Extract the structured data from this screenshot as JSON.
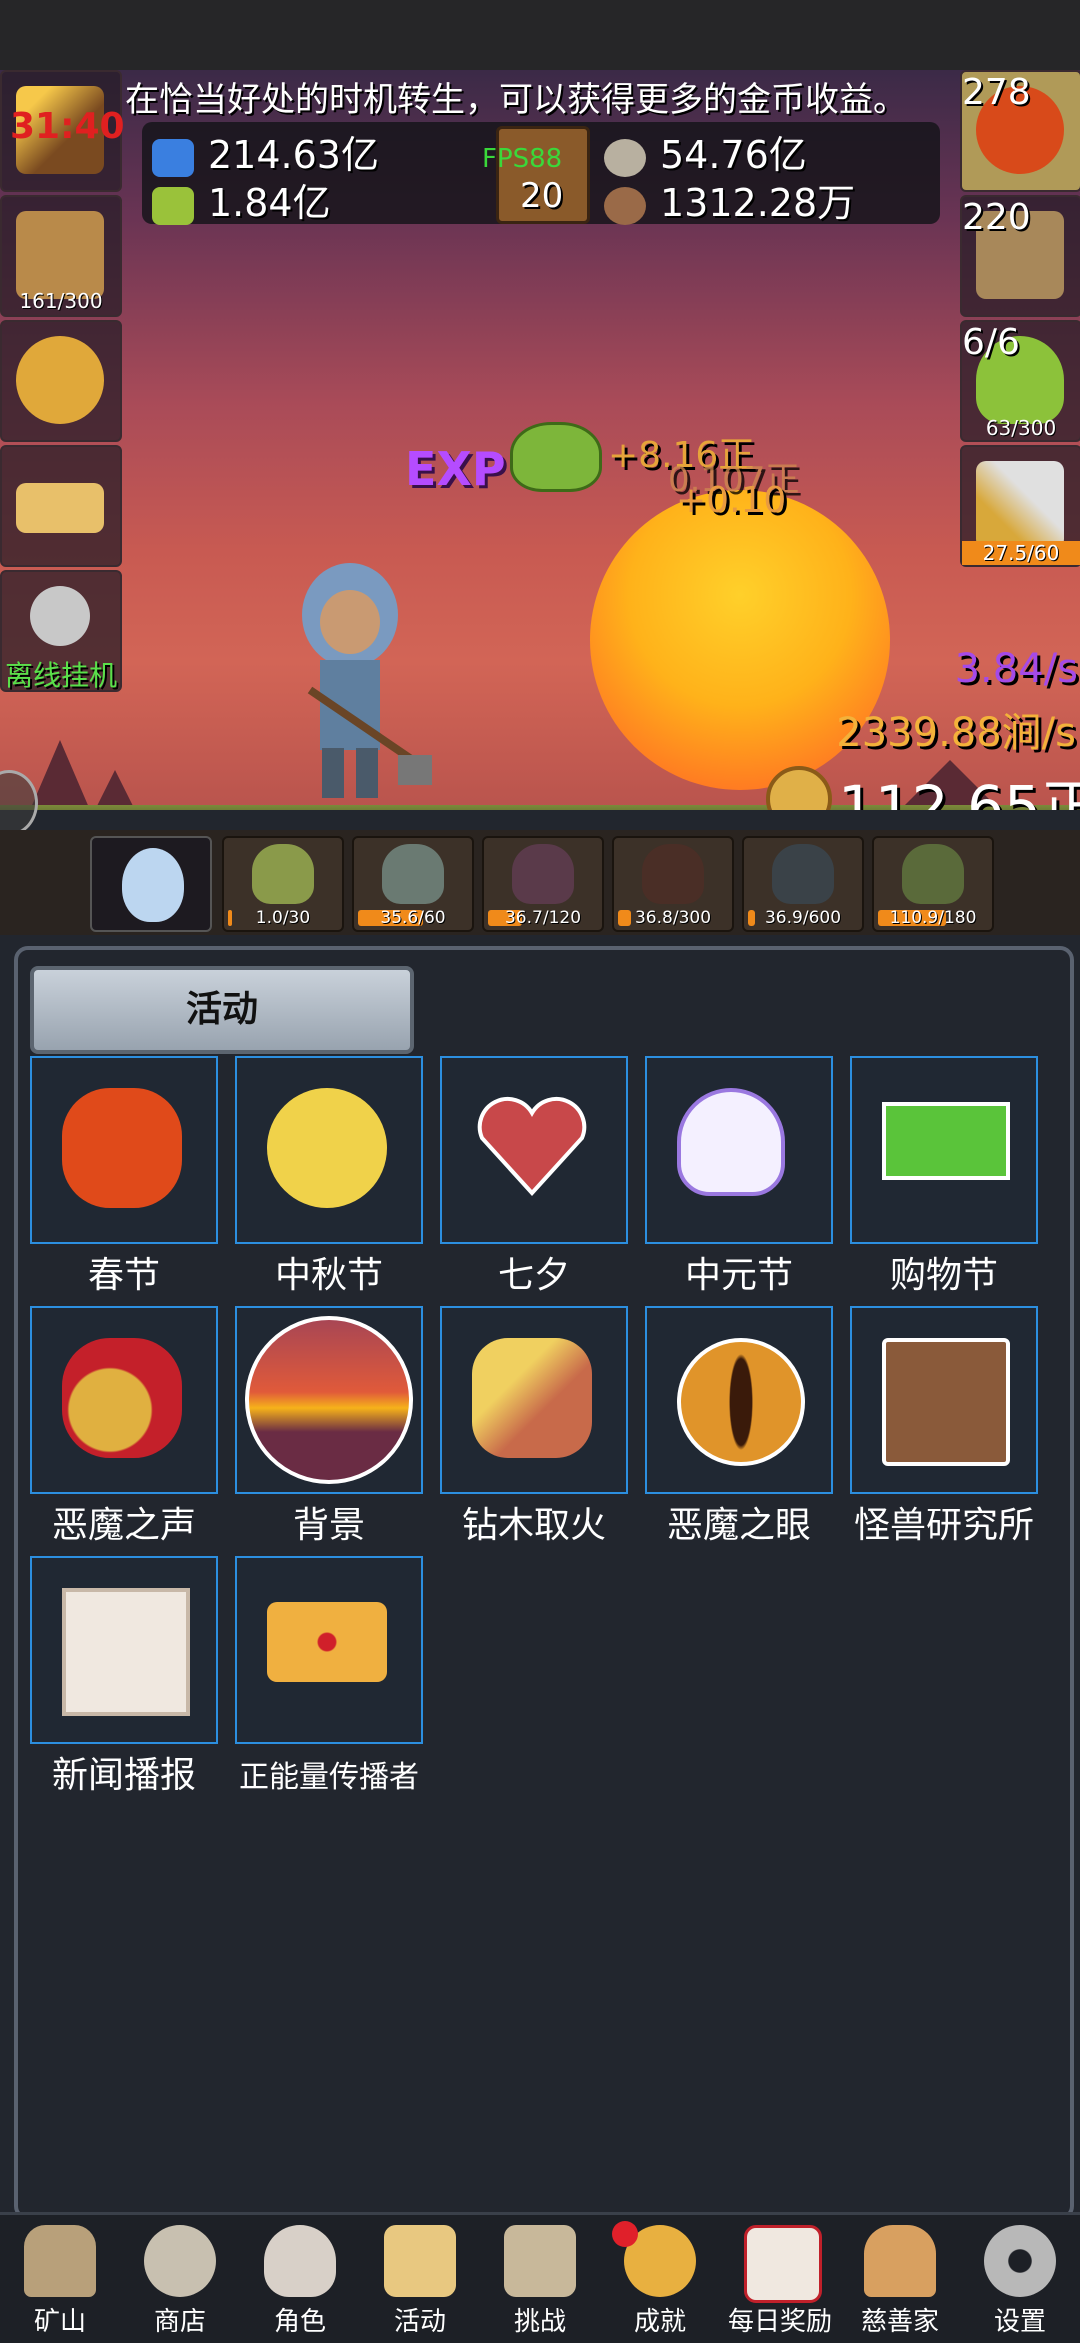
{
  "tip": "在恰当好处的时机转生，可以获得更多的金币收益。",
  "top_left_timer": "31:40",
  "side_left": [
    {
      "name": "torch",
      "count": ""
    },
    {
      "name": "beer",
      "count": "161/300"
    },
    {
      "name": "golden-key",
      "count": ""
    },
    {
      "name": "gold-bar",
      "count": ""
    },
    {
      "name": "offline-key",
      "count": "离线挂机"
    }
  ],
  "side_right": [
    {
      "name": "potion",
      "count": "278"
    },
    {
      "name": "chest",
      "count": "220"
    },
    {
      "name": "slime",
      "count": "6/6",
      "sub": "63/300"
    },
    {
      "name": "sword",
      "count": "",
      "sub": "27.5/60"
    }
  ],
  "resources": {
    "r1": "214.63亿",
    "r2": "1.84亿",
    "r3": "54.76亿",
    "r4": "1312.28万",
    "fps": "FPS88",
    "book": "20"
  },
  "float": {
    "exp": "EXP",
    "g1": "+8.16正",
    "g2": "0.107正",
    "g3": "+0.10"
  },
  "rates": {
    "purple": "3.84/s",
    "gold": "2339.88涧/s",
    "coins": "112.65正"
  },
  "monsters": [
    {
      "name": "egg",
      "count": "",
      "fill": 0
    },
    {
      "name": "slime",
      "count": "1.0/30",
      "fill": 0.03
    },
    {
      "name": "zombie",
      "count": "35.6/60",
      "fill": 0.59
    },
    {
      "name": "bat",
      "count": "36.7/120",
      "fill": 0.31
    },
    {
      "name": "spider",
      "count": "36.8/300",
      "fill": 0.12
    },
    {
      "name": "ghost",
      "count": "36.9/600",
      "fill": 0.06
    },
    {
      "name": "orc",
      "count": "110.9/180",
      "fill": 0.62
    }
  ],
  "section_title": "活动",
  "activities": [
    {
      "label": "春节",
      "icon": "lantern"
    },
    {
      "label": "中秋节",
      "icon": "moon"
    },
    {
      "label": "七夕",
      "icon": "heart"
    },
    {
      "label": "中元节",
      "icon": "ghost"
    },
    {
      "label": "购物节",
      "icon": "money"
    },
    {
      "label": "恶魔之声",
      "icon": "bell"
    },
    {
      "label": "背景",
      "icon": "sunset"
    },
    {
      "label": "钻木取火",
      "icon": "fire-stick"
    },
    {
      "label": "恶魔之眼",
      "icon": "eye"
    },
    {
      "label": "怪兽研究所",
      "icon": "lab"
    },
    {
      "label": "新闻播报",
      "icon": "news"
    },
    {
      "label": "正能量传播者",
      "icon": "crown"
    }
  ],
  "nav": [
    {
      "label": "矿山",
      "icon": "lantern"
    },
    {
      "label": "商店",
      "icon": "stone"
    },
    {
      "label": "角色",
      "icon": "skull"
    },
    {
      "label": "活动",
      "icon": "scroll"
    },
    {
      "label": "挑战",
      "icon": "map"
    },
    {
      "label": "成就",
      "icon": "key"
    },
    {
      "label": "每日奖励",
      "icon": "letter"
    },
    {
      "label": "慈善家",
      "icon": "bread"
    },
    {
      "label": "设置",
      "icon": "gear"
    }
  ],
  "colors": {
    "tile_border": "#2c8fe0",
    "accent_orange": "#f08a1a",
    "rate_purple": "#a44ae8",
    "rate_gold": "#f3b23a"
  }
}
